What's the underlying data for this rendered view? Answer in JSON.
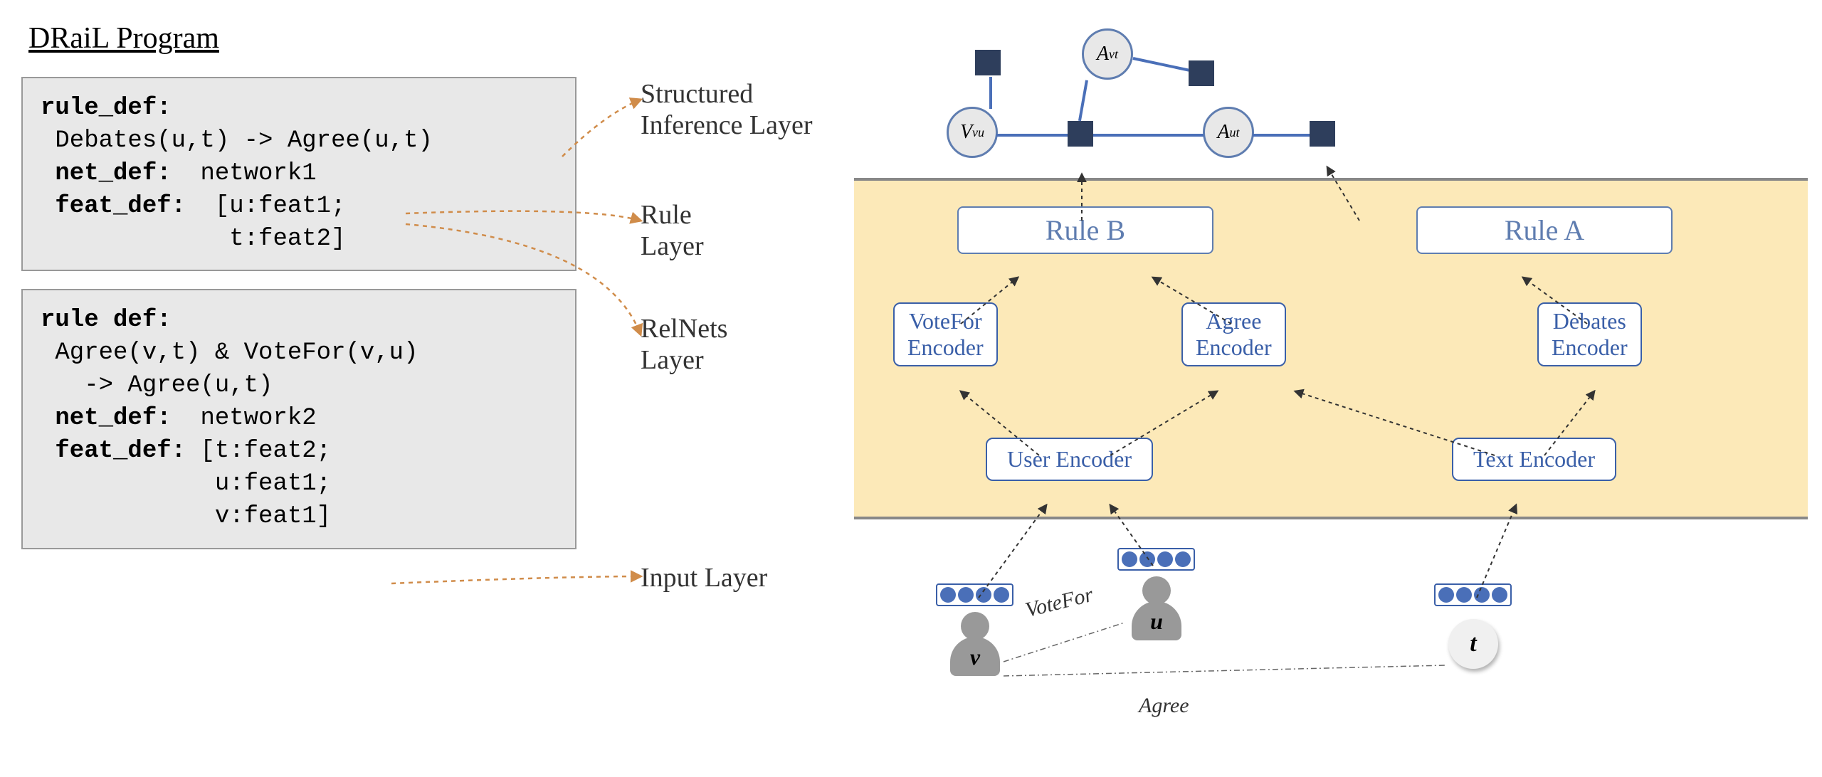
{
  "title": "DRaiL Program",
  "code_box_1": {
    "l1a": "rule_def:",
    "l2": " Debates(u,t) -> Agree(u,t)",
    "l3a": " net_def:",
    "l3b": "  network1",
    "l4a": " feat_def:",
    "l4b": "  [u:feat1;",
    "l5": "             t:feat2]"
  },
  "code_box_2": {
    "l1a": "rule def:",
    "l2": " Agree(v,t) & VoteFor(v,u)",
    "l3": "   -> Agree(u,t)",
    "l4a": " net_def:",
    "l4b": "  network2",
    "l5a": " feat_def:",
    "l5b": " [t:feat2;",
    "l6": "            u:feat1;",
    "l7": "            v:feat1]"
  },
  "layer_labels": {
    "structured": "Structured\nInference Layer",
    "rule": "Rule\nLayer",
    "relnets": "RelNets\nLayer",
    "input": "Input Layer"
  },
  "rules": {
    "a": "Rule A",
    "b": "Rule B"
  },
  "encoders": {
    "votefor": "VoteFor\nEncoder",
    "agree": "Agree\nEncoder",
    "debates": "Debates\nEncoder",
    "user": "User Encoder",
    "text": "Text Encoder"
  },
  "inputs": {
    "v": "v",
    "u": "u",
    "t": "t",
    "votefor": "VoteFor",
    "agree": "Agree"
  },
  "graph": {
    "vvu": "V",
    "vvu_sub": "vu",
    "avt": "A",
    "avt_sub": "vt",
    "aut": "A",
    "aut_sub": "ut"
  }
}
